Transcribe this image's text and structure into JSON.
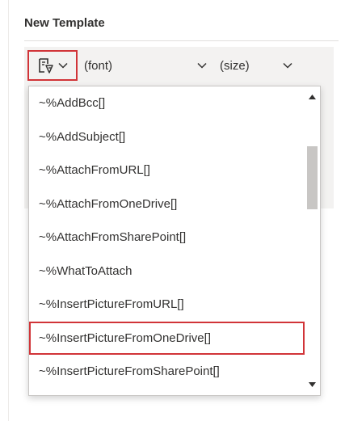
{
  "panel": {
    "title": "New Template"
  },
  "toolbar": {
    "insert_button_icon": "insert-template-icon",
    "font_value": "(font)",
    "size_value": "(size)"
  },
  "dropdown": {
    "items": [
      "~%AddBcc[]",
      "~%AddSubject[]",
      "~%AttachFromURL[]",
      "~%AttachFromOneDrive[]",
      "~%AttachFromSharePoint[]",
      "~%WhatToAttach",
      "~%InsertPictureFromURL[]",
      "~%InsertPictureFromOneDrive[]",
      "~%InsertPictureFromSharePoint[]"
    ],
    "highlighted_index": 7
  },
  "colors": {
    "highlight_border": "#d13438",
    "editor_background": "#f3f2f1",
    "text": "#323130",
    "scrollbar_thumb": "#c8c6c4"
  }
}
